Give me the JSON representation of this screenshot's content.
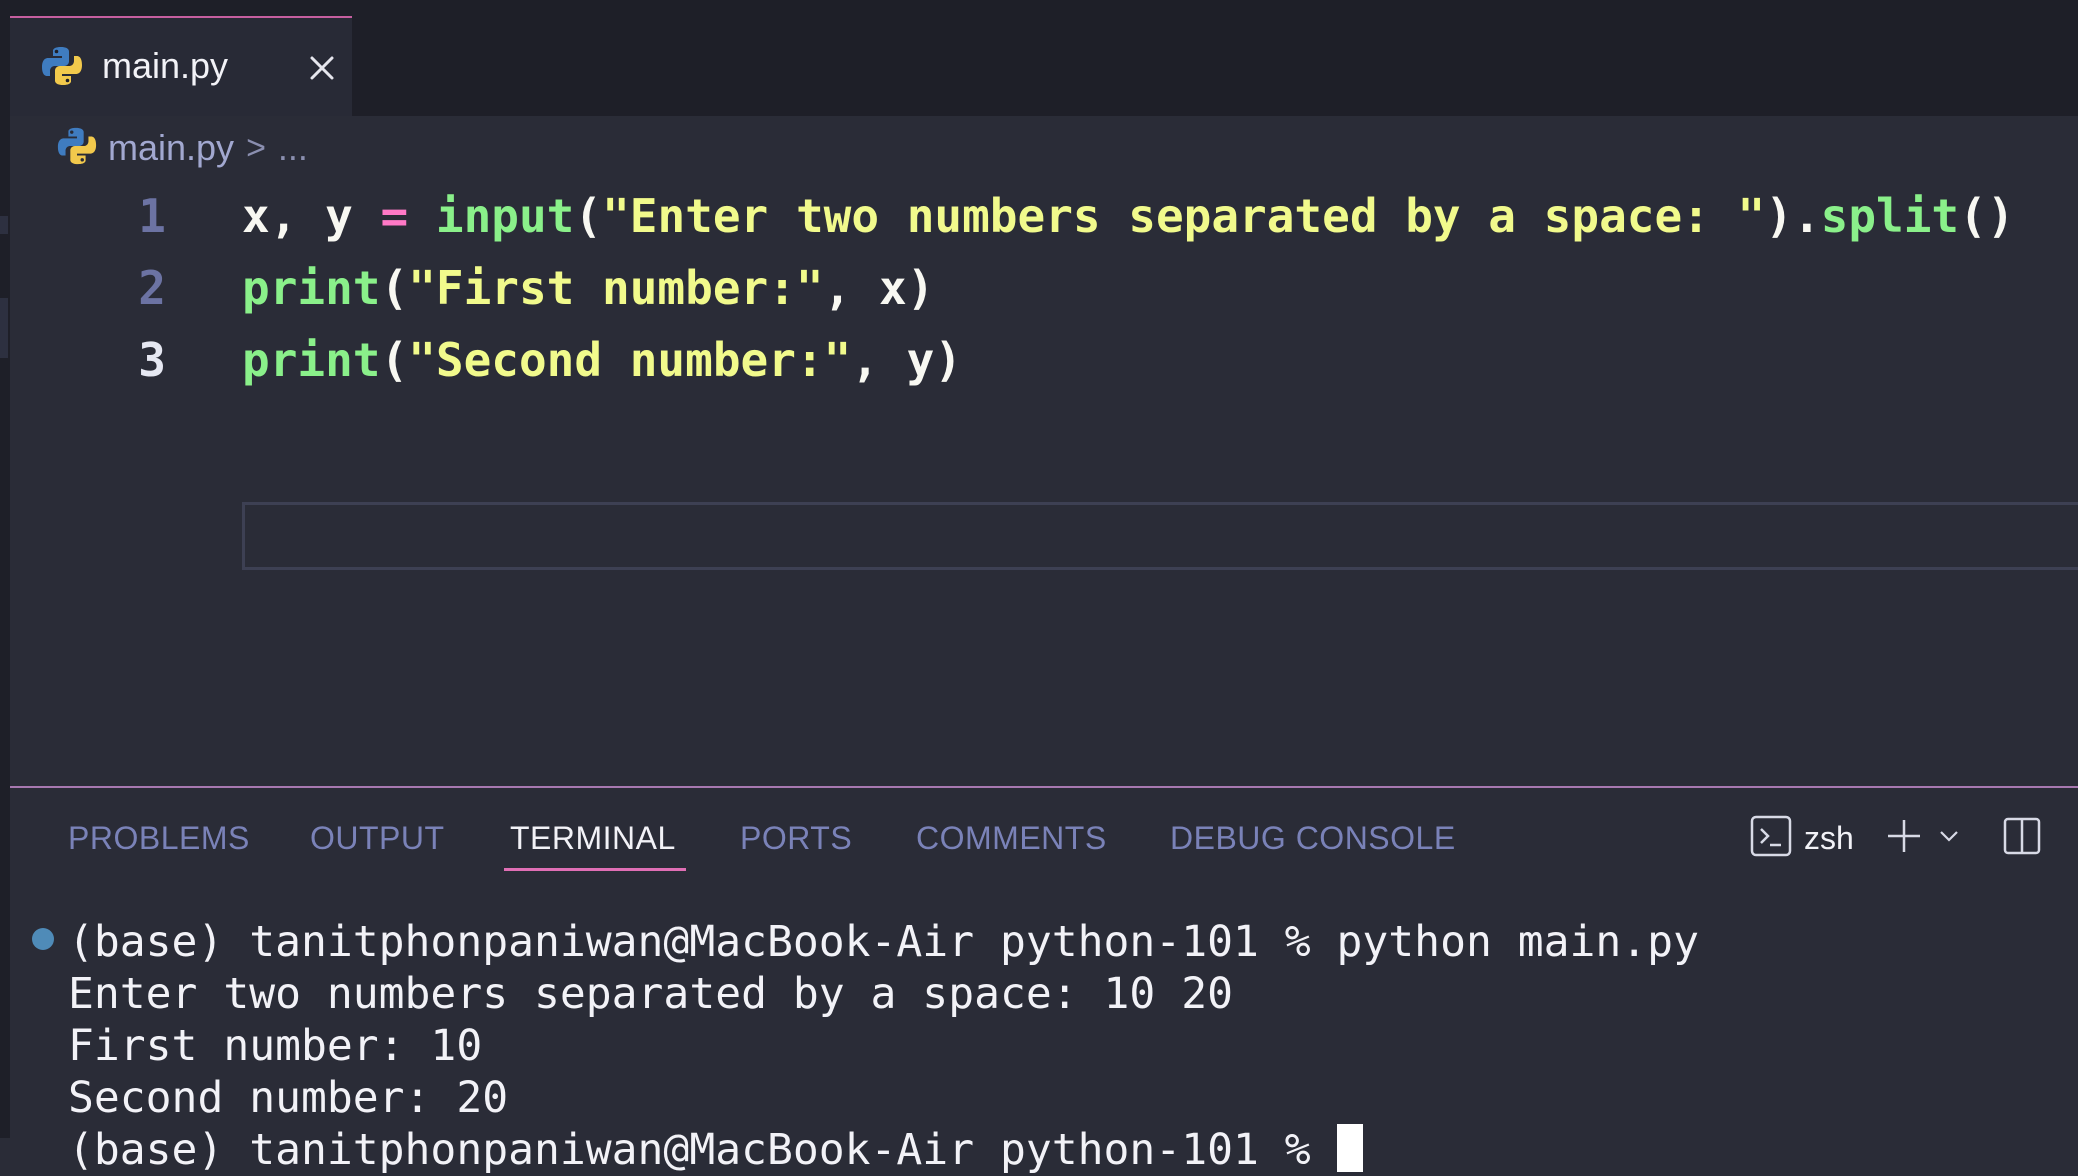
{
  "tab": {
    "label": "main.py",
    "icon": "python-icon",
    "close_icon": "close-icon"
  },
  "breadcrumb": {
    "file": "main.py",
    "separator": ">",
    "more": "..."
  },
  "editor": {
    "line_numbers": [
      "1",
      "2",
      "3"
    ],
    "lines": [
      {
        "tokens": [
          {
            "t": "x, y ",
            "c": "pl"
          },
          {
            "t": "=",
            "c": "op"
          },
          {
            "t": " ",
            "c": "pl"
          },
          {
            "t": "input",
            "c": "fn"
          },
          {
            "t": "(",
            "c": "pl"
          },
          {
            "t": "\"Enter two numbers separated by a space: \"",
            "c": "str"
          },
          {
            "t": ").",
            "c": "pl"
          },
          {
            "t": "split",
            "c": "fn"
          },
          {
            "t": "()",
            "c": "pl"
          }
        ]
      },
      {
        "tokens": [
          {
            "t": "print",
            "c": "fn"
          },
          {
            "t": "(",
            "c": "pl"
          },
          {
            "t": "\"First number:\"",
            "c": "str"
          },
          {
            "t": ", x)",
            "c": "pl"
          }
        ]
      },
      {
        "tokens": [
          {
            "t": "print",
            "c": "fn"
          },
          {
            "t": "(",
            "c": "pl"
          },
          {
            "t": "\"Second number:\"",
            "c": "str"
          },
          {
            "t": ", y)",
            "c": "pl"
          }
        ]
      }
    ]
  },
  "panel": {
    "tabs": [
      "PROBLEMS",
      "OUTPUT",
      "TERMINAL",
      "PORTS",
      "COMMENTS",
      "DEBUG CONSOLE"
    ],
    "active_tab": "TERMINAL",
    "shell": "zsh"
  },
  "terminal": {
    "lines": [
      "(base) tanitphonpaniwan@MacBook-Air python-101 % python main.py",
      "Enter two numbers separated by a space: 10 20",
      "First number: 10",
      "Second number: 20",
      "(base) tanitphonpaniwan@MacBook-Air python-101 % "
    ]
  },
  "colors": {
    "function": "#8af08a",
    "string": "#f1fa8c",
    "operator": "#ff79c6",
    "accent": "#e06fb5"
  }
}
